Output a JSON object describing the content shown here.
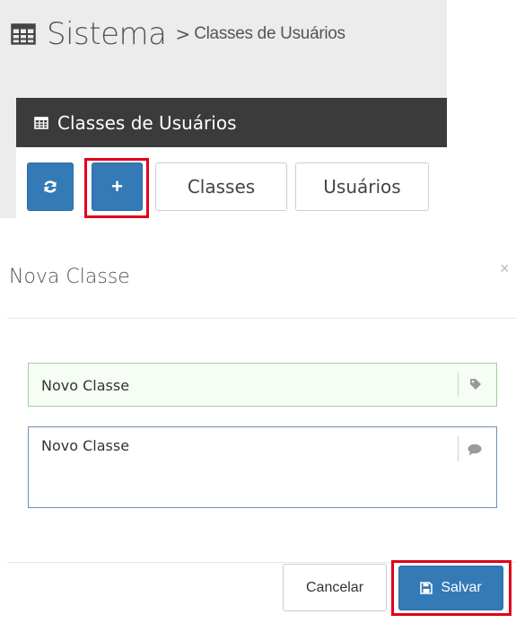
{
  "header": {
    "title": "Sistema",
    "breadcrumb_sep": ">",
    "breadcrumb_current": "Classes de Usuários",
    "title_icon": "table-icon"
  },
  "panel": {
    "title": "Classes de Usuários",
    "title_icon": "table-icon",
    "toolbar": {
      "refresh_icon": "refresh-icon",
      "add_label": "+",
      "classes_label": "Classes",
      "users_label": "Usuários"
    }
  },
  "modal": {
    "title": "Nova Classe",
    "close_label": "×",
    "name_field": {
      "value": "Novo Classe",
      "icon": "tag-icon"
    },
    "description_field": {
      "value": "Novo Classe",
      "icon": "comment-icon"
    },
    "cancel_label": "Cancelar",
    "save_label": "Salvar",
    "save_icon": "floppy-disk-icon"
  },
  "colors": {
    "primary": "#337ab7",
    "panel_header": "#3b3b3b",
    "highlight": "#e0001b",
    "success_border": "#9fd19a",
    "focus_border": "#6f8fb8"
  }
}
